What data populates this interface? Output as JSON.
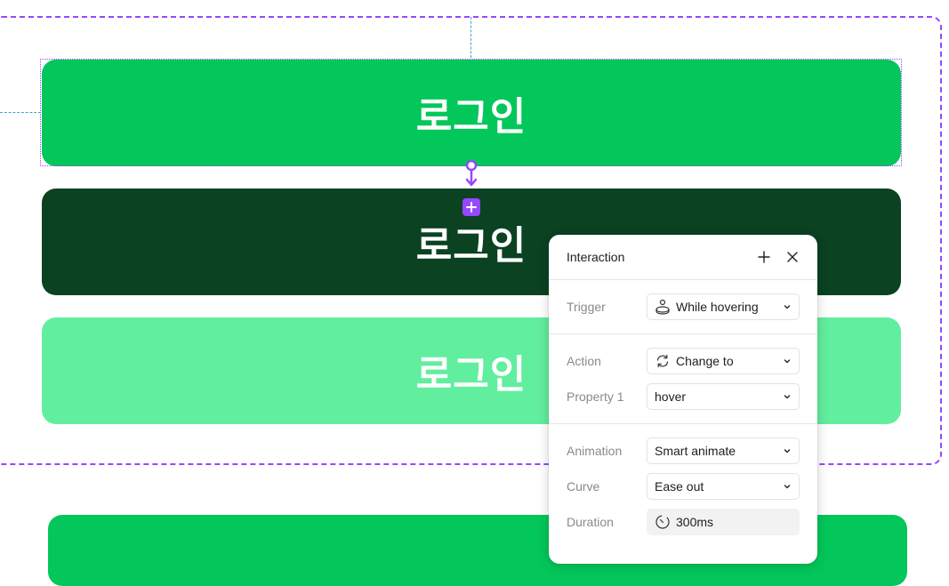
{
  "canvas": {
    "variants": [
      {
        "label": "로그인",
        "color": "#03c75a"
      },
      {
        "label": "로그인",
        "color": "#0a4222"
      },
      {
        "label": "로그인",
        "color": "#62ee9f"
      }
    ],
    "accent": "#9747ff",
    "add_icon": "plus-icon",
    "connector_icon": "prototype-connector-icon"
  },
  "panel": {
    "title": "Interaction",
    "add_icon": "plus-icon",
    "close_icon": "close-icon",
    "trigger": {
      "label": "Trigger",
      "value": "While hovering",
      "icon": "hover-icon"
    },
    "action": {
      "label": "Action",
      "value": "Change to",
      "icon": "swap-icon"
    },
    "property": {
      "label": "Property 1",
      "value": "hover"
    },
    "animation": {
      "label": "Animation",
      "value": "Smart animate"
    },
    "curve": {
      "label": "Curve",
      "value": "Ease out"
    },
    "duration": {
      "label": "Duration",
      "value": "300ms",
      "icon": "timer-icon"
    }
  }
}
